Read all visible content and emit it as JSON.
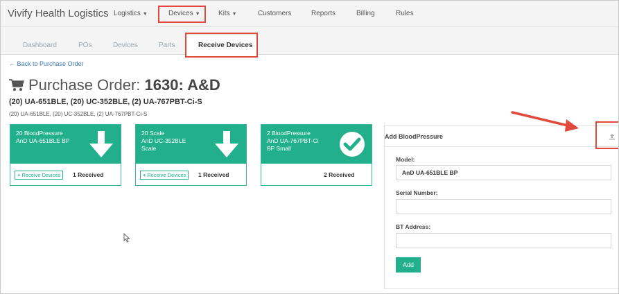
{
  "app": {
    "brand": "Vivify Health Logistics"
  },
  "nav": {
    "items": [
      {
        "label": "Logistics",
        "dropdown": true
      },
      {
        "label": "Devices",
        "dropdown": true
      },
      {
        "label": "Kits",
        "dropdown": true
      },
      {
        "label": "Customers",
        "dropdown": false
      },
      {
        "label": "Reports",
        "dropdown": false
      },
      {
        "label": "Billing",
        "dropdown": false
      },
      {
        "label": "Rules",
        "dropdown": false
      }
    ],
    "caret": "▼"
  },
  "subnav": {
    "tabs": [
      {
        "label": "Dashboard"
      },
      {
        "label": "POs"
      },
      {
        "label": "Devices"
      },
      {
        "label": "Parts"
      },
      {
        "label": "Receive Devices",
        "active": true
      }
    ]
  },
  "back_link": "← Back to Purchase Order",
  "purchase_order": {
    "title_prefix": "Purchase Order:",
    "title_id": "1630: A&D",
    "summary": "(20) UA-651BLE, (20) UC-352BLE, (2) UA-767PBT-Ci-S",
    "detail": "(20) UA-651BLE, (20) UC-352BLE, (2) UA-767PBT-Ci-S"
  },
  "cards": [
    {
      "line1": "20 BloodPressure",
      "line2": "AnD UA-651BLE BP",
      "line3": "",
      "icon": "arrow-down-icon",
      "button": "Receive Devices",
      "received": "1 Received"
    },
    {
      "line1": "20 Scale",
      "line2": "AnD UC-352BLE",
      "line3": "Scale",
      "icon": "arrow-down-icon",
      "button": "Receive Devices",
      "received": "1 Received"
    },
    {
      "line1": "2 BloodPressure",
      "line2": "AnD UA-767PBT-Ci",
      "line3": "BP Small",
      "icon": "check-circle-icon",
      "button": "",
      "received": "2 Received"
    }
  ],
  "panel": {
    "title": "Add BloodPressure",
    "model_label": "Model:",
    "model_value": "AnD UA-651BLE BP",
    "serial_label": "Serial Number:",
    "serial_value": "",
    "bt_label": "BT Address:",
    "bt_value": "",
    "add_label": "Add"
  },
  "colors": {
    "accent": "#22b08c",
    "highlight": "#e0493c",
    "link": "#3a78b8"
  }
}
